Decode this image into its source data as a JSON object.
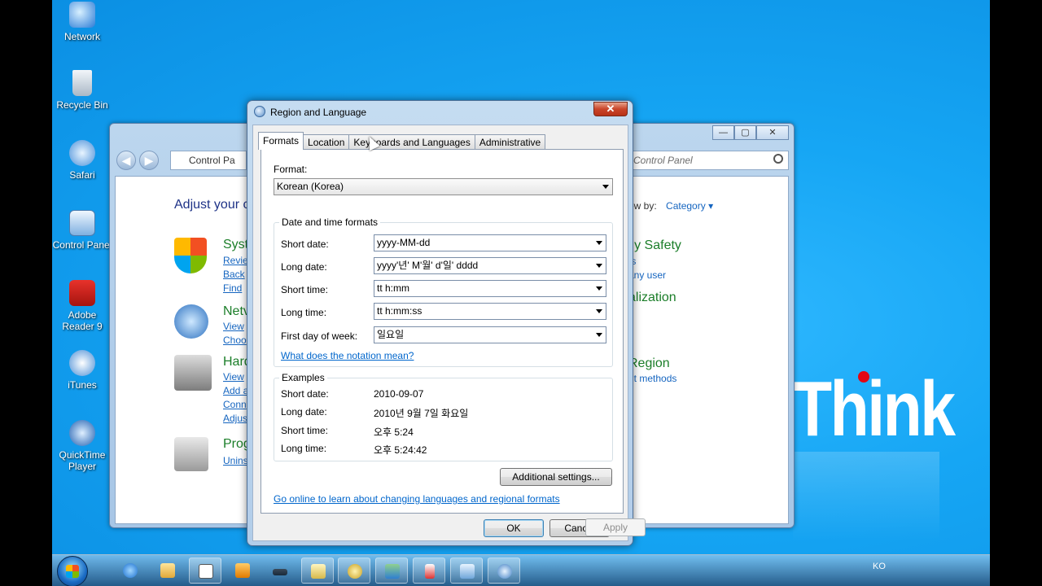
{
  "desktop": {
    "icons": [
      {
        "label": "Network"
      },
      {
        "label": "Recycle Bin"
      },
      {
        "label": "Safari"
      },
      {
        "label": "Control Panel"
      },
      {
        "label": "Adobe Reader 9"
      },
      {
        "label": "iTunes"
      },
      {
        "label": "QuickTime Player"
      }
    ],
    "wallpaper_logo": "Think"
  },
  "control_panel": {
    "address": "Control Pa",
    "search_placeholder": "Control Panel",
    "heading": "Adjust your c",
    "view_by_label": "ew by:",
    "view_by_value": "Category",
    "categories": [
      {
        "title": "Syst",
        "links": [
          "Revie",
          "Back",
          "Find"
        ]
      },
      {
        "title": "Netv",
        "links": [
          "View",
          "Choo"
        ]
      },
      {
        "title": "Hard",
        "links": [
          "View",
          "Add a",
          "Conn",
          "Adjus"
        ]
      },
      {
        "title": "Prog",
        "links": [
          "Unins"
        ]
      }
    ],
    "right_column": [
      {
        "text": "ily Safety",
        "kind": "title"
      },
      {
        "text": "ts",
        "kind": "link"
      },
      {
        "text": "any user",
        "kind": "link"
      },
      {
        "text": "alization",
        "kind": "title"
      },
      {
        "text": "Region",
        "kind": "title"
      },
      {
        "text": "ut methods",
        "kind": "link"
      }
    ]
  },
  "dialog": {
    "title": "Region and Language",
    "close": "✕",
    "tabs": [
      "Formats",
      "Location",
      "Keyboards and Languages",
      "Administrative"
    ],
    "active_tab": "Formats",
    "format_label": "Format:",
    "format_value": "Korean (Korea)",
    "date_time_group": "Date and time formats",
    "fields": [
      {
        "label": "Short date:",
        "value": "yyyy-MM-dd"
      },
      {
        "label": "Long date:",
        "value": "yyyy'년' M'월' d'일' dddd"
      },
      {
        "label": "Short time:",
        "value": "tt h:mm"
      },
      {
        "label": "Long time:",
        "value": "tt h:mm:ss"
      },
      {
        "label": "First day of week:",
        "value": "일요일"
      }
    ],
    "notation_link": "What does the notation mean?",
    "examples_group": "Examples",
    "examples": [
      {
        "label": "Short date:",
        "value": "2010-09-07"
      },
      {
        "label": "Long date:",
        "value": "2010년 9월 7일 화요일"
      },
      {
        "label": "Short time:",
        "value": "오후 5:24"
      },
      {
        "label": "Long time:",
        "value": "오후 5:24:42"
      }
    ],
    "additional_settings": "Additional settings...",
    "online_link": "Go online to learn about changing languages and regional formats",
    "ok": "OK",
    "cancel": "Cancel",
    "apply": "Apply"
  },
  "taskbar": {
    "language": "KO"
  }
}
